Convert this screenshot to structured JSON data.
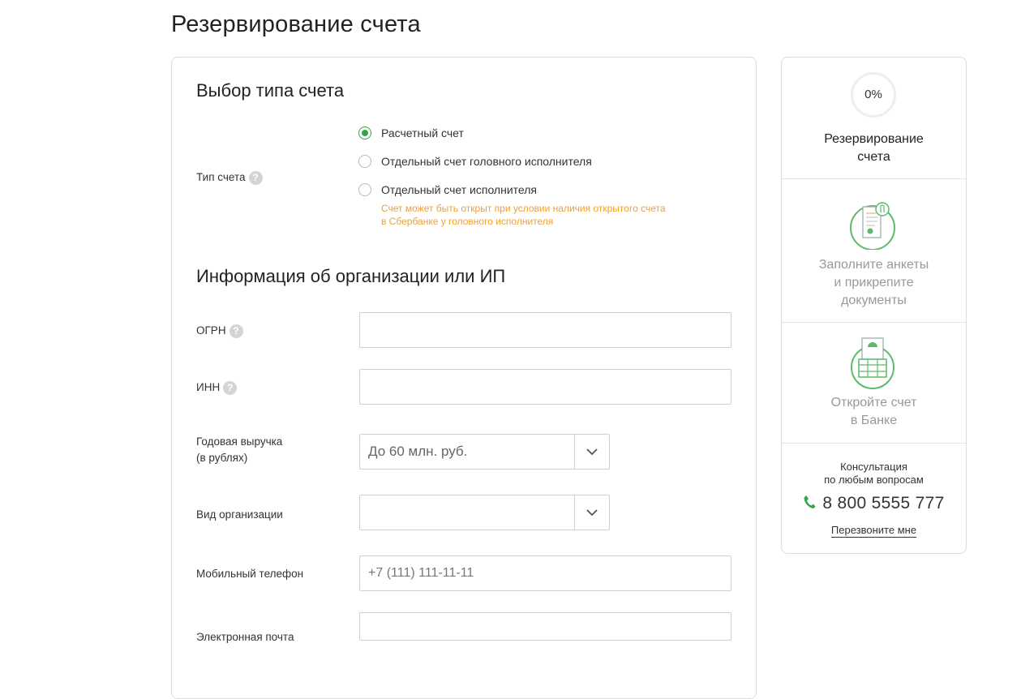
{
  "page": {
    "title": "Резервирование счета"
  },
  "account_type": {
    "section_title": "Выбор типа счета",
    "label": "Тип счета",
    "options": [
      {
        "label": "Расчетный счет",
        "checked": true
      },
      {
        "label": "Отдельный счет головного исполнителя",
        "checked": false
      },
      {
        "label": "Отдельный счет исполнителя",
        "checked": false
      }
    ],
    "note_line1": "Счет может быть открыт при условии наличия открытого счета",
    "note_line2": "в Сбербанке у головного исполнителя"
  },
  "organization": {
    "section_title": "Информация об организации или ИП",
    "ogrn_label": "ОГРН",
    "ogrn_value": "",
    "inn_label": "ИНН",
    "inn_value": "",
    "revenue_label_line1": "Годовая выручка",
    "revenue_label_line2": "(в рублях)",
    "revenue_value": "До 60 млн. руб.",
    "org_type_label": "Вид организации",
    "org_type_value": "",
    "phone_label": "Мобильный телефон",
    "phone_placeholder": "+7 (111) 111-11-11",
    "email_label": "Электронная почта",
    "email_value": ""
  },
  "help_icon_glyph": "?",
  "sidebar": {
    "progress": "0%",
    "progress_fraction": 0,
    "steps": [
      {
        "title_line1": "Резервирование",
        "title_line2": "счета",
        "active": true
      },
      {
        "title_line1": "Заполните анкеты",
        "title_line2": "и прикрепите",
        "title_line3": "документы",
        "active": false,
        "icon": "documents-icon"
      },
      {
        "title_line1": "Откройте счет",
        "title_line2": "в Банке",
        "active": false,
        "icon": "bank-icon"
      }
    ],
    "consult_line1": "Консультация",
    "consult_line2": "по любым вопросам",
    "phone": "8 800 5555 777",
    "callback": "Перезвоните мне"
  },
  "colors": {
    "accent": "#3aa34a",
    "warning": "#f0a030",
    "muted_text": "#999999",
    "border": "#dcdcdc"
  }
}
